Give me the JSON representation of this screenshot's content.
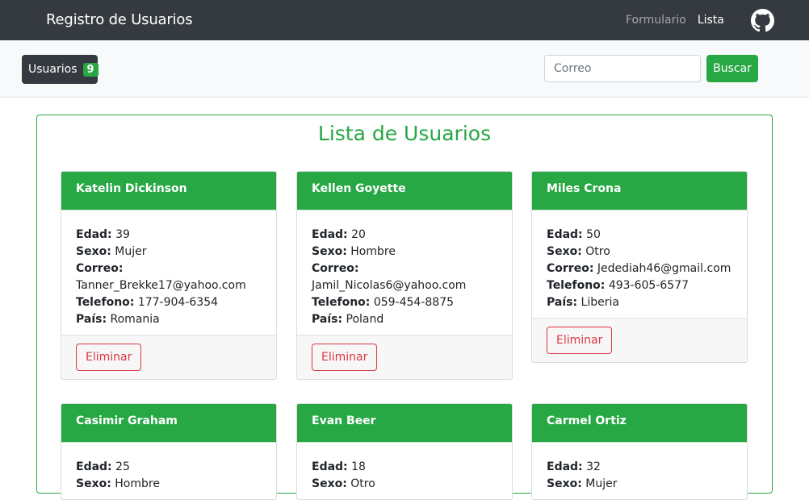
{
  "navbar": {
    "brand": "Registro de Usuarios",
    "links": [
      "Formulario",
      "Lista"
    ],
    "active_link": "Lista",
    "github_icon": "github-icon"
  },
  "toolbar": {
    "users_label": "Usuarios",
    "users_count": "9",
    "search_placeholder": "Correo",
    "search_button": "Buscar"
  },
  "main": {
    "title": "Lista de Usuarios",
    "labels": {
      "edad": "Edad:",
      "sexo": "Sexo:",
      "correo": "Correo:",
      "telefono": "Telefono:",
      "pais": "País:"
    },
    "delete_label": "Eliminar",
    "cards": [
      {
        "name": "Katelin Dickinson",
        "edad": "39",
        "sexo": "Mujer",
        "correo": "Tanner_Brekke17@yahoo.com",
        "telefono": "177-904-6354",
        "pais": "Romania"
      },
      {
        "name": "Kellen Goyette",
        "edad": "20",
        "sexo": "Hombre",
        "correo": "Jamil_Nicolas6@yahoo.com",
        "telefono": "059-454-8875",
        "pais": "Poland"
      },
      {
        "name": "Miles Crona",
        "edad": "50",
        "sexo": "Otro",
        "correo": "Jedediah46@gmail.com",
        "telefono": "493-605-6577",
        "pais": "Liberia"
      },
      {
        "name": "Casimir Graham",
        "edad": "25",
        "sexo": "Hombre"
      },
      {
        "name": "Evan Beer",
        "edad": "18",
        "sexo": "Otro"
      },
      {
        "name": "Carmel Ortiz",
        "edad": "32",
        "sexo": "Mujer"
      }
    ]
  },
  "colors": {
    "navbar": "#343a40",
    "accent": "#28a745",
    "danger": "#dc3545"
  }
}
